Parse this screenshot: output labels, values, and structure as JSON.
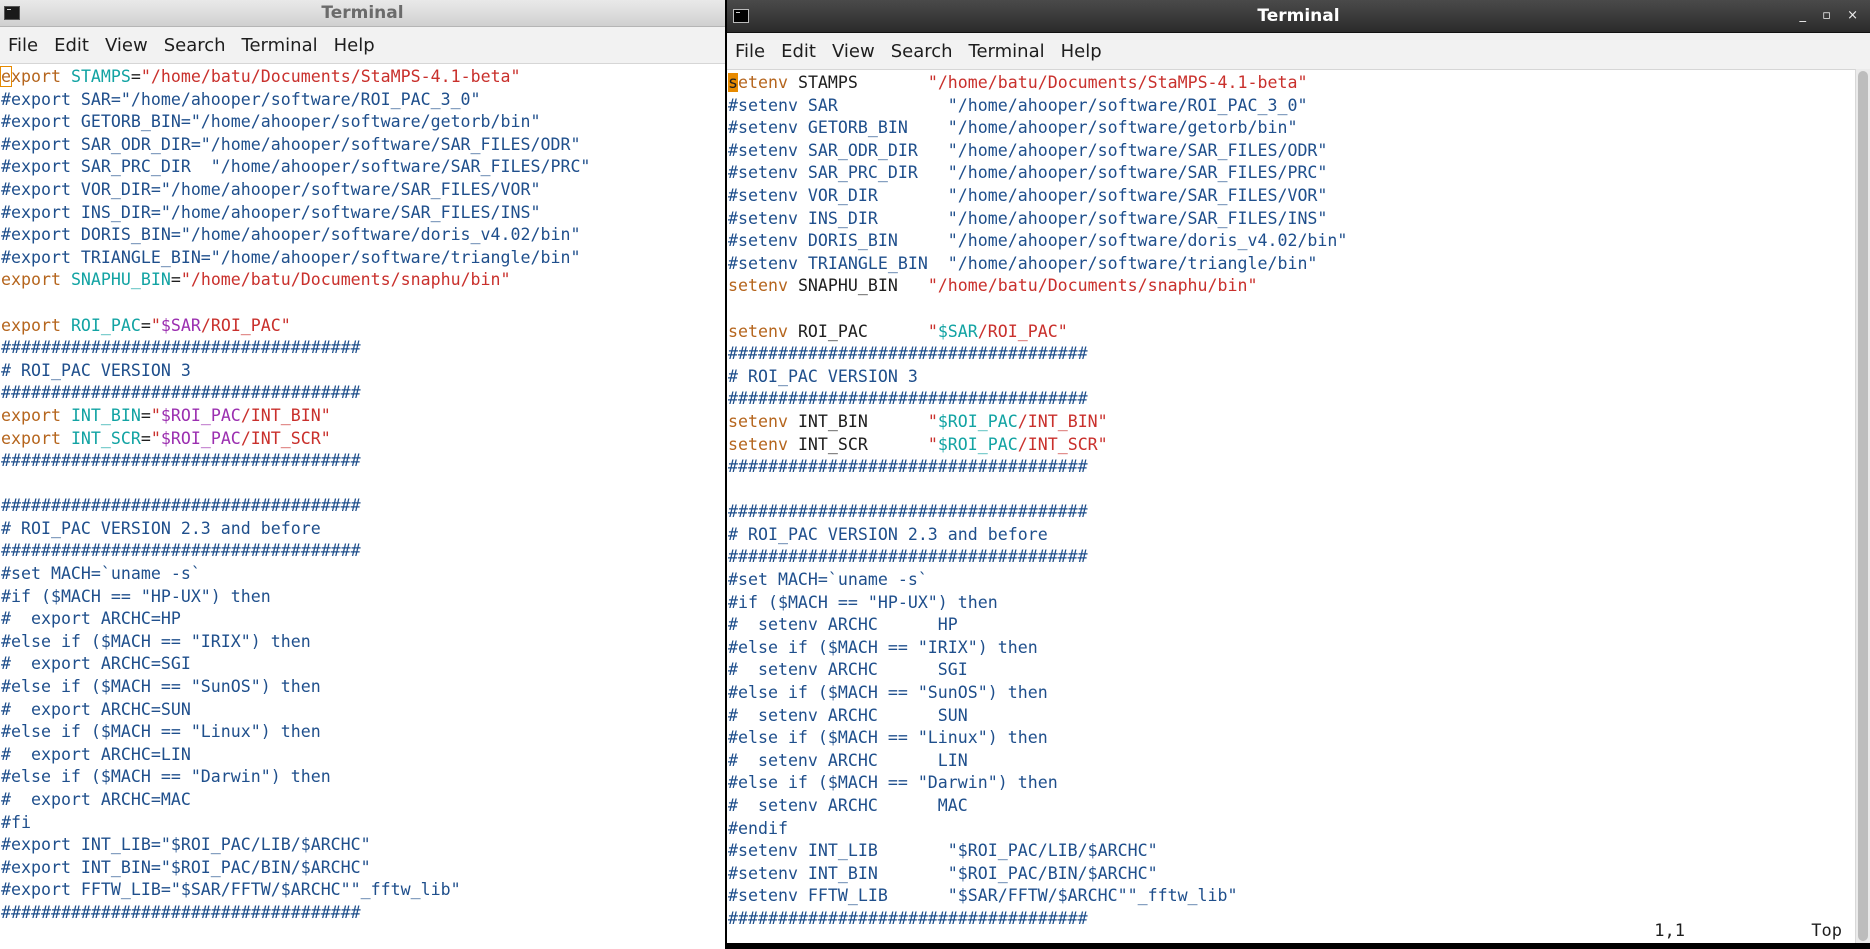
{
  "left": {
    "title": "Terminal",
    "menu": [
      "File",
      "Edit",
      "View",
      "Search",
      "Terminal",
      "Help"
    ],
    "lines": [
      [
        [
          "kw",
          "e",
          "cbox"
        ],
        [
          "kw",
          "xport "
        ],
        [
          "var",
          "STAMPS"
        ],
        [
          "plain",
          "="
        ],
        [
          "str",
          "\"/home/batu/Documents/StaMPS-4.1-beta\""
        ]
      ],
      [
        [
          "com",
          "#export SAR=\"/home/ahooper/software/ROI_PAC_3_0\""
        ]
      ],
      [
        [
          "com",
          "#export GETORB_BIN=\"/home/ahooper/software/getorb/bin\""
        ]
      ],
      [
        [
          "com",
          "#export SAR_ODR_DIR=\"/home/ahooper/software/SAR_FILES/ODR\""
        ]
      ],
      [
        [
          "com",
          "#export SAR_PRC_DIR  \"/home/ahooper/software/SAR_FILES/PRC\""
        ]
      ],
      [
        [
          "com",
          "#export VOR_DIR=\"/home/ahooper/software/SAR_FILES/VOR\""
        ]
      ],
      [
        [
          "com",
          "#export INS_DIR=\"/home/ahooper/software/SAR_FILES/INS\""
        ]
      ],
      [
        [
          "com",
          "#export DORIS_BIN=\"/home/ahooper/software/doris_v4.02/bin\""
        ]
      ],
      [
        [
          "com",
          "#export TRIANGLE_BIN=\"/home/ahooper/software/triangle/bin\""
        ]
      ],
      [
        [
          "kw",
          "export "
        ],
        [
          "var",
          "SNAPHU_BIN"
        ],
        [
          "plain",
          "="
        ],
        [
          "str",
          "\"/home/batu/Documents/snaphu/bin\""
        ]
      ],
      [],
      [
        [
          "kw",
          "export "
        ],
        [
          "var",
          "ROI_PAC"
        ],
        [
          "plain",
          "="
        ],
        [
          "str",
          "\""
        ],
        [
          "sub",
          "$SAR"
        ],
        [
          "str",
          "/ROI_PAC\""
        ]
      ],
      [
        [
          "com",
          "####################################"
        ]
      ],
      [
        [
          "com",
          "# ROI_PAC VERSION 3"
        ]
      ],
      [
        [
          "com",
          "####################################"
        ]
      ],
      [
        [
          "kw",
          "export "
        ],
        [
          "var",
          "INT_BIN"
        ],
        [
          "plain",
          "="
        ],
        [
          "str",
          "\""
        ],
        [
          "sub",
          "$ROI_PAC"
        ],
        [
          "str",
          "/INT_BIN\""
        ]
      ],
      [
        [
          "kw",
          "export "
        ],
        [
          "var",
          "INT_SCR"
        ],
        [
          "plain",
          "="
        ],
        [
          "str",
          "\""
        ],
        [
          "sub",
          "$ROI_PAC"
        ],
        [
          "str",
          "/INT_SCR\""
        ]
      ],
      [
        [
          "com",
          "####################################"
        ]
      ],
      [],
      [
        [
          "com",
          "####################################"
        ]
      ],
      [
        [
          "com",
          "# ROI_PAC VERSION 2.3 and before"
        ]
      ],
      [
        [
          "com",
          "####################################"
        ]
      ],
      [
        [
          "com",
          "#set MACH=`uname -s`"
        ]
      ],
      [
        [
          "com",
          "#if ($MACH == \"HP-UX\") then"
        ]
      ],
      [
        [
          "com",
          "#  export ARCHC=HP"
        ]
      ],
      [
        [
          "com",
          "#else if ($MACH == \"IRIX\") then"
        ]
      ],
      [
        [
          "com",
          "#  export ARCHC=SGI"
        ]
      ],
      [
        [
          "com",
          "#else if ($MACH == \"SunOS\") then"
        ]
      ],
      [
        [
          "com",
          "#  export ARCHC=SUN"
        ]
      ],
      [
        [
          "com",
          "#else if ($MACH == \"Linux\") then"
        ]
      ],
      [
        [
          "com",
          "#  export ARCHC=LIN"
        ]
      ],
      [
        [
          "com",
          "#else if ($MACH == \"Darwin\") then"
        ]
      ],
      [
        [
          "com",
          "#  export ARCHC=MAC"
        ]
      ],
      [
        [
          "com",
          "#fi"
        ]
      ],
      [
        [
          "com",
          "#export INT_LIB=\"$ROI_PAC/LIB/$ARCHC\""
        ]
      ],
      [
        [
          "com",
          "#export INT_BIN=\"$ROI_PAC/BIN/$ARCHC\""
        ]
      ],
      [
        [
          "com",
          "#export FFTW_LIB=\"$SAR/FFTW/$ARCHC\"\"_fftw_lib\""
        ]
      ],
      [
        [
          "com",
          "####################################"
        ]
      ]
    ]
  },
  "right": {
    "title": "Terminal",
    "window_controls": "_ ▫ ×",
    "menu": [
      "File",
      "Edit",
      "View",
      "Search",
      "Terminal",
      "Help"
    ],
    "lines": [
      [
        [
          "plain",
          "s",
          "cursor"
        ],
        [
          "kw",
          "etenv "
        ],
        [
          "plain",
          "STAMPS       "
        ],
        [
          "str",
          "\"/home/batu/Documents/StaMPS-4.1-beta\""
        ]
      ],
      [
        [
          "com",
          "#setenv SAR           \"/home/ahooper/software/ROI_PAC_3_0\""
        ]
      ],
      [
        [
          "com",
          "#setenv GETORB_BIN    \"/home/ahooper/software/getorb/bin\""
        ]
      ],
      [
        [
          "com",
          "#setenv SAR_ODR_DIR   \"/home/ahooper/software/SAR_FILES/ODR\""
        ]
      ],
      [
        [
          "com",
          "#setenv SAR_PRC_DIR   \"/home/ahooper/software/SAR_FILES/PRC\""
        ]
      ],
      [
        [
          "com",
          "#setenv VOR_DIR       \"/home/ahooper/software/SAR_FILES/VOR\""
        ]
      ],
      [
        [
          "com",
          "#setenv INS_DIR       \"/home/ahooper/software/SAR_FILES/INS\""
        ]
      ],
      [
        [
          "com",
          "#setenv DORIS_BIN     \"/home/ahooper/software/doris_v4.02/bin\""
        ]
      ],
      [
        [
          "com",
          "#setenv TRIANGLE_BIN  \"/home/ahooper/software/triangle/bin\""
        ]
      ],
      [
        [
          "kw",
          "setenv "
        ],
        [
          "plain",
          "SNAPHU_BIN   "
        ],
        [
          "str",
          "\"/home/batu/Documents/snaphu/bin\""
        ]
      ],
      [],
      [
        [
          "kw",
          "setenv "
        ],
        [
          "plain",
          "ROI_PAC      "
        ],
        [
          "str",
          "\""
        ],
        [
          "var",
          "$SAR"
        ],
        [
          "str",
          "/ROI_PAC\""
        ]
      ],
      [
        [
          "com",
          "####################################"
        ]
      ],
      [
        [
          "com",
          "# ROI_PAC VERSION 3"
        ]
      ],
      [
        [
          "com",
          "####################################"
        ]
      ],
      [
        [
          "kw",
          "setenv "
        ],
        [
          "plain",
          "INT_BIN      "
        ],
        [
          "str",
          "\""
        ],
        [
          "var",
          "$ROI_PAC"
        ],
        [
          "str",
          "/INT_BIN\""
        ]
      ],
      [
        [
          "kw",
          "setenv "
        ],
        [
          "plain",
          "INT_SCR      "
        ],
        [
          "str",
          "\""
        ],
        [
          "var",
          "$ROI_PAC"
        ],
        [
          "str",
          "/INT_SCR\""
        ]
      ],
      [
        [
          "com",
          "####################################"
        ]
      ],
      [],
      [
        [
          "com",
          "####################################"
        ]
      ],
      [
        [
          "com",
          "# ROI_PAC VERSION 2.3 and before"
        ]
      ],
      [
        [
          "com",
          "####################################"
        ]
      ],
      [
        [
          "com",
          "#set MACH=`uname -s`"
        ]
      ],
      [
        [
          "com",
          "#if ($MACH == \"HP-UX\") then"
        ]
      ],
      [
        [
          "com",
          "#  setenv ARCHC      HP"
        ]
      ],
      [
        [
          "com",
          "#else if ($MACH == \"IRIX\") then"
        ]
      ],
      [
        [
          "com",
          "#  setenv ARCHC      SGI"
        ]
      ],
      [
        [
          "com",
          "#else if ($MACH == \"SunOS\") then"
        ]
      ],
      [
        [
          "com",
          "#  setenv ARCHC      SUN"
        ]
      ],
      [
        [
          "com",
          "#else if ($MACH == \"Linux\") then"
        ]
      ],
      [
        [
          "com",
          "#  setenv ARCHC      LIN"
        ]
      ],
      [
        [
          "com",
          "#else if ($MACH == \"Darwin\") then"
        ]
      ],
      [
        [
          "com",
          "#  setenv ARCHC      MAC"
        ]
      ],
      [
        [
          "com",
          "#endif"
        ]
      ],
      [
        [
          "com",
          "#setenv INT_LIB       \"$ROI_PAC/LIB/$ARCHC\""
        ]
      ],
      [
        [
          "com",
          "#setenv INT_BIN       \"$ROI_PAC/BIN/$ARCHC\""
        ]
      ],
      [
        [
          "com",
          "#setenv FFTW_LIB      \"$SAR/FFTW/$ARCHC\"\"_fftw_lib\""
        ]
      ],
      [
        [
          "com",
          "####################################"
        ]
      ]
    ],
    "status_position": "1,1",
    "status_scroll": "Top"
  },
  "colors": {
    "comment": "#1f4f8c",
    "keyword": "#b5651d",
    "string": "#c9302c",
    "variable": "#12a3a3",
    "substitution": "#9b2fb0",
    "cursor": "#e78a00"
  }
}
